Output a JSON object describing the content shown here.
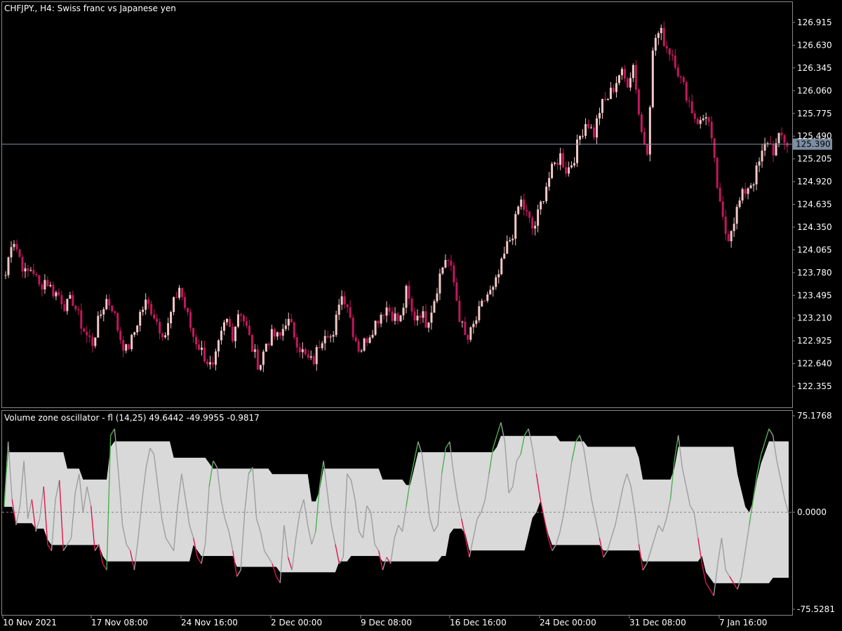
{
  "main_title": "CHFJPY., H4:  Swiss franc vs Japanese yen",
  "osc_title": "Volume zone oscillator - fl (14,25) 49.6442 -49.9955 -0.9817",
  "price_ticks": [
    "126.915",
    "126.630",
    "126.345",
    "126.060",
    "125.775",
    "125.490",
    "125.205",
    "124.920",
    "124.635",
    "124.350",
    "124.065",
    "123.780",
    "123.495",
    "123.210",
    "122.925",
    "122.640",
    "122.355"
  ],
  "current_price": "125.390",
  "osc_ticks": [
    "75.1768",
    "0.0000",
    "-75.5281"
  ],
  "time_labels": [
    "10 Nov 2021",
    "17 Nov 08:00",
    "24 Nov 16:00",
    "2 Dec 00:00",
    "9 Dec 08:00",
    "16 Dec 16:00",
    "24 Dec 00:00",
    "31 Dec 08:00",
    "7 Jan 16:00"
  ],
  "colors": {
    "bull": "#f4c7c7",
    "bear": "#c2185b",
    "osc_line": "#9e9e9e",
    "band": "#d9d9d9",
    "up_seg": "#4caf50",
    "down_seg": "#e0154d",
    "grid": "#888888"
  },
  "chart_data": [
    {
      "type": "candlestick",
      "title": "CHFJPY., H4:  Swiss franc vs Japanese yen",
      "ylim": [
        122.25,
        127.0
      ],
      "y_ticks": [
        126.915,
        126.63,
        126.345,
        126.06,
        125.775,
        125.49,
        125.205,
        124.92,
        124.635,
        124.35,
        124.065,
        123.78,
        123.495,
        123.21,
        122.925,
        122.64,
        122.355
      ],
      "current_price": 125.39,
      "close_path": [
        123.75,
        124.25,
        124.0,
        123.75,
        123.85,
        123.6,
        123.7,
        123.55,
        123.5,
        123.35,
        123.45,
        123.2,
        123.0,
        122.9,
        123.2,
        123.45,
        123.35,
        123.0,
        122.8,
        122.95,
        123.25,
        123.4,
        123.3,
        123.1,
        123.0,
        123.35,
        123.6,
        123.3,
        123.0,
        122.85,
        122.7,
        122.55,
        122.9,
        123.2,
        123.0,
        123.35,
        123.1,
        122.8,
        122.6,
        122.9,
        123.0,
        122.95,
        123.2,
        123.05,
        122.85,
        122.7,
        122.65,
        122.9,
        123.1,
        122.9,
        123.5,
        123.45,
        123.05,
        122.8,
        122.95,
        123.1,
        123.25,
        123.35,
        123.25,
        123.15,
        123.55,
        123.2,
        123.3,
        123.15,
        123.4,
        123.75,
        124.0,
        123.7,
        123.2,
        122.9,
        123.1,
        123.3,
        123.5,
        123.55,
        123.8,
        124.1,
        124.3,
        124.7,
        124.5,
        124.3,
        124.6,
        124.9,
        125.1,
        125.25,
        125.05,
        125.2,
        125.5,
        125.7,
        125.5,
        125.85,
        125.95,
        126.1,
        126.3,
        126.15,
        126.4,
        125.6,
        125.3,
        126.7,
        126.8,
        126.6,
        126.5,
        126.2,
        126.0,
        125.75,
        125.65,
        125.8,
        125.2,
        124.55,
        124.2,
        124.45,
        124.7,
        124.85,
        124.95,
        125.2,
        125.45,
        125.3,
        125.5,
        125.39
      ]
    },
    {
      "type": "line",
      "title": "Volume zone oscillator - fl (14,25) 49.6442 -49.9955 -0.9817",
      "ylim": [
        -75.5281,
        75.1768
      ],
      "zero_line": 0,
      "values": [
        5,
        55,
        10,
        -10,
        5,
        40,
        -5,
        10,
        -15,
        -5,
        20,
        -25,
        -30,
        10,
        25,
        -30,
        -25,
        -20,
        15,
        30,
        0,
        20,
        5,
        -30,
        -25,
        -40,
        -45,
        60,
        65,
        30,
        -10,
        -25,
        -30,
        -45,
        -20,
        10,
        35,
        50,
        45,
        20,
        -5,
        -20,
        -25,
        -30,
        5,
        30,
        10,
        -10,
        -20,
        -35,
        -40,
        -25,
        20,
        40,
        35,
        10,
        -5,
        -15,
        -30,
        -50,
        -45,
        0,
        30,
        35,
        -5,
        -15,
        -30,
        -35,
        -40,
        -50,
        -55,
        -10,
        -35,
        -45,
        -20,
        0,
        10,
        -10,
        -25,
        -15,
        20,
        40,
        15,
        -10,
        -25,
        -40,
        -35,
        30,
        25,
        10,
        -15,
        -20,
        5,
        0,
        -25,
        -30,
        -45,
        -35,
        -40,
        -20,
        -10,
        -15,
        5,
        25,
        40,
        55,
        45,
        20,
        -5,
        -15,
        -10,
        30,
        50,
        55,
        30,
        10,
        -5,
        -20,
        -35,
        -20,
        -5,
        0,
        10,
        30,
        50,
        60,
        70,
        55,
        15,
        20,
        40,
        45,
        60,
        65,
        50,
        30,
        10,
        -5,
        -20,
        -30,
        -25,
        -15,
        0,
        20,
        40,
        55,
        60,
        50,
        30,
        10,
        -5,
        -20,
        -35,
        -30,
        -20,
        -10,
        5,
        20,
        30,
        20,
        0,
        -25,
        -45,
        -40,
        -30,
        -20,
        -10,
        -15,
        -5,
        10,
        40,
        60,
        35,
        20,
        5,
        0,
        -20,
        -40,
        -55,
        -60,
        -65,
        -40,
        -20,
        -45,
        -50,
        -55,
        -60,
        -50,
        -30,
        -10,
        10,
        30,
        45,
        55,
        65,
        60,
        40,
        25,
        10,
        -1
      ]
    }
  ]
}
